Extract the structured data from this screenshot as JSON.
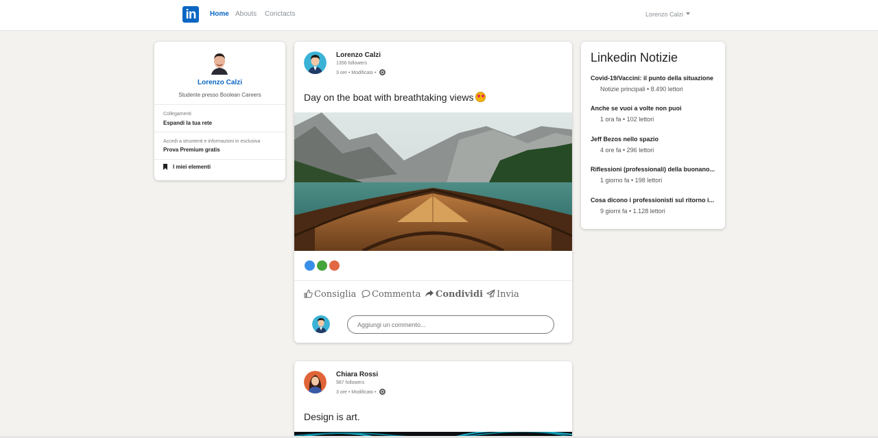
{
  "navbar": {
    "logo_text": "in",
    "links": [
      "Home",
      "Abouts",
      "Conctacts"
    ],
    "user_name": "Lorenzo Calzi"
  },
  "profile": {
    "name": "Lorenzo Calzi",
    "role": "Studente presso Boolean Careers",
    "connections_label": "Collegamenti",
    "connections_link": "Espandi la tua rete",
    "premium_label": "Accedi a strumenti e informazioni in esclusiva",
    "premium_link": "Prova Premium gratis",
    "my_items": "I miei elementi"
  },
  "posts": [
    {
      "author": "Lorenzo Calzi",
      "followers": "1356 followers",
      "meta": "3 ore • Modificato •",
      "text": "Day on the boat with breathtaking views",
      "comment_placeholder": "Aggiungi un commento..."
    },
    {
      "author": "Chiara Rossi",
      "followers": "987 followers",
      "meta": "3 ore • Modificato •",
      "text": "Design is art."
    }
  ],
  "actions": {
    "like": "Consiglia",
    "comment": "Commenta",
    "share": "Condividi",
    "send": "Invia"
  },
  "news": {
    "title": "Linkedin Notizie",
    "items": [
      {
        "headline": "Covid-19/Vaccini: il punto della situazione",
        "meta": "Notizie principali • 8.490 lettori"
      },
      {
        "headline": "Anche se vuoi a volte non puoi",
        "meta": "1 ora fa • 102 lettori"
      },
      {
        "headline": "Jeff Bezos nello spazio",
        "meta": "4 ore fa • 296 lettori"
      },
      {
        "headline": "Riflessioni (professionali) della buonano...",
        "meta": "1 giorno fa • 198 lettori"
      },
      {
        "headline": "Cosa dicono i professionisti sul ritorno i...",
        "meta": "9 giorni fa • 1.128 lettori"
      }
    ]
  },
  "colors": {
    "brand": "#0a66c2",
    "background": "#f3f2ef"
  }
}
